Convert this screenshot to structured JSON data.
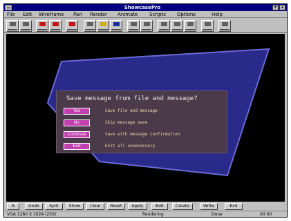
{
  "window": {
    "title": "ShowcasePro"
  },
  "menu": [
    {
      "label": "File"
    },
    {
      "label": "Edit"
    },
    {
      "label": "Wireframe"
    },
    {
      "label": "Pan"
    },
    {
      "label": "Render"
    },
    {
      "label": "Animate"
    },
    {
      "label": "Scripts"
    },
    {
      "label": "Options"
    },
    {
      "label": "Help"
    }
  ],
  "dialog": {
    "prompt": "Save message from file and message?",
    "options": [
      {
        "button": "Yes",
        "text": "Save file and message"
      },
      {
        "button": "No",
        "text": "Skip message save"
      },
      {
        "button": "Continue",
        "text": "Save with message confirmation"
      },
      {
        "button": "Exit",
        "text": "Exit all unnecessary"
      }
    ]
  },
  "commands": [
    {
      "label": "A"
    },
    {
      "label": "Undo"
    },
    {
      "label": "Split"
    },
    {
      "label": "Show"
    },
    {
      "label": "Clear"
    },
    {
      "label": "Reset"
    },
    {
      "label": "Apply"
    },
    {
      "label": "Edit"
    },
    {
      "label": "Create"
    },
    {
      "label": "Write"
    },
    {
      "label": "Exit"
    }
  ],
  "status": {
    "left": "VGA 1280 X 1024 (256)",
    "mid": "Rendering",
    "right1": "Done",
    "right2": "00:00"
  },
  "colors": {
    "canvas": "#000000",
    "polygon_fill": "#2a2a8a",
    "polygon_stroke": "#6a6ad8",
    "dialog_bg": "#4a3a4a",
    "button_magenta": "#c040b0",
    "dialog_text": "#f0d8a8",
    "title_bar": "#000080"
  }
}
